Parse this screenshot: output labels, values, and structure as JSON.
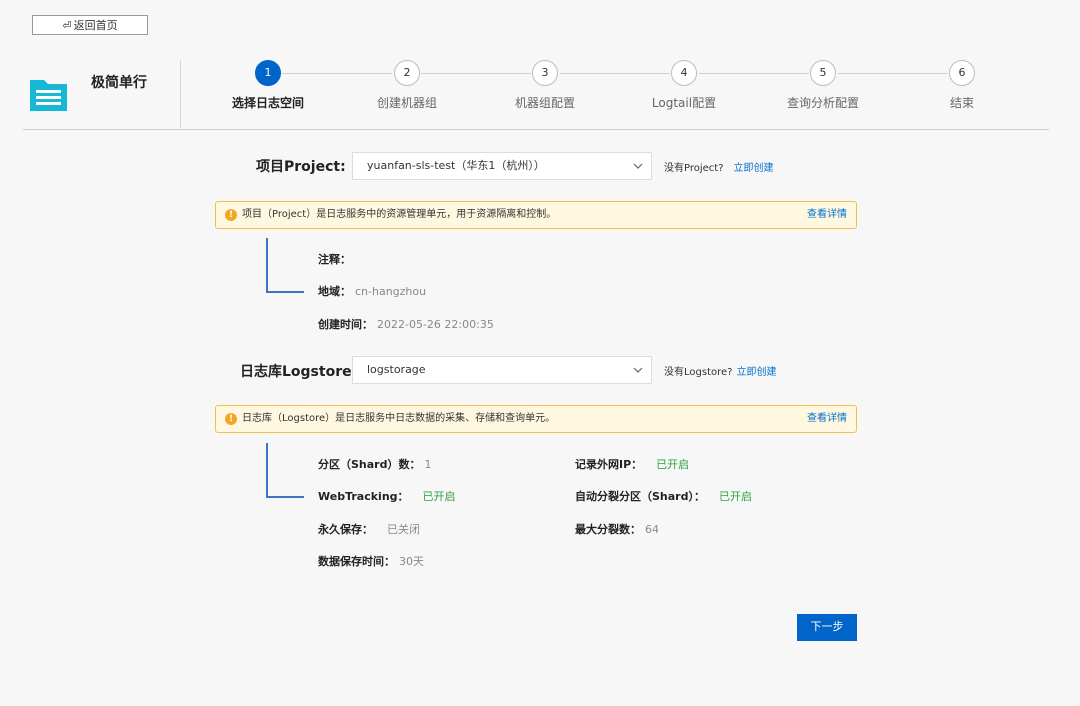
{
  "back_label": "返回首页",
  "app_title": "极简单行",
  "steps": [
    {
      "num": "1",
      "label": "选择日志空间"
    },
    {
      "num": "2",
      "label": "创建机器组"
    },
    {
      "num": "3",
      "label": "机器组配置"
    },
    {
      "num": "4",
      "label": "Logtail配置"
    },
    {
      "num": "5",
      "label": "查询分析配置"
    },
    {
      "num": "6",
      "label": "结束"
    }
  ],
  "project": {
    "label": "项目Project:",
    "value": "yuanfan-sls-test（华东1（杭州））",
    "hint": "没有Project?",
    "create_link": "立即创建",
    "notice": "项目（Project）是日志服务中的资源管理单元，用于资源隔离和控制。",
    "notice_link": "查看详情",
    "info": {
      "note_k": "注释：",
      "region_k": "地域：",
      "region_v": "cn-hangzhou",
      "created_k": "创建时间：",
      "created_v": "2022-05-26 22:00:35"
    }
  },
  "logstore": {
    "label": "日志库Logstore:",
    "value": "logstorage",
    "hint": "没有Logstore?",
    "create_link": "立即创建",
    "notice": "日志库（Logstore）是日志服务中日志数据的采集、存储和查询单元。",
    "notice_link": "查看详情",
    "info": {
      "shard_k": "分区（Shard）数：",
      "shard_v": "1",
      "webtracking_k": "WebTracking：",
      "webtracking_v": "已开启",
      "permanent_k": "永久保存：",
      "permanent_v": "已关闭",
      "retention_k": "数据保存时间：",
      "retention_v": "30天",
      "public_ip_k": "记录外网IP：",
      "public_ip_v": "已开启",
      "auto_split_k": "自动分裂分区（Shard）：",
      "auto_split_v": "已开启",
      "max_split_k": "最大分裂数：",
      "max_split_v": "64"
    }
  },
  "next_label": "下一步",
  "colors": {
    "primary": "#0064c8",
    "link": "#0070cc",
    "enabled": "#2ea043",
    "warning": "#f5a623"
  }
}
